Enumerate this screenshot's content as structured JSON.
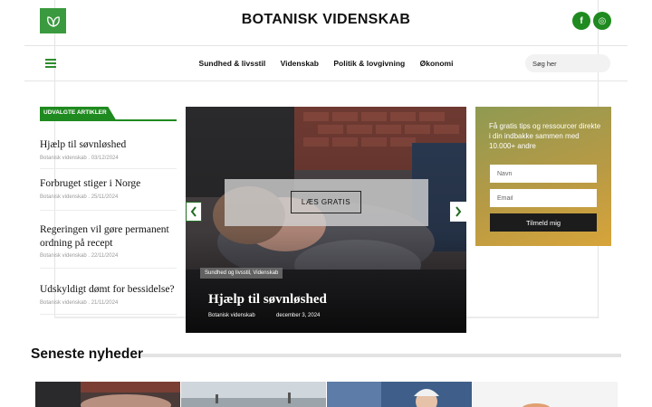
{
  "header": {
    "site_title": "BOTANISK VIDENSKAB",
    "logo_icon": "leaf-icon",
    "social": [
      {
        "icon": "facebook-icon",
        "glyph": "f"
      },
      {
        "icon": "instagram-icon",
        "glyph": "◎"
      }
    ]
  },
  "nav": {
    "menu_icon": "hamburger-menu-icon",
    "links": [
      "Sundhed & livsstil",
      "Videnskab",
      "Politik & lovgivning",
      "Økonomi"
    ],
    "search_placeholder": "Søg her"
  },
  "featured": {
    "label": "UDVALGTE ARTIKLER",
    "articles": [
      {
        "title": "Hjælp til søvnløshed",
        "meta": "Botanisk videnskab . 03/12/2024"
      },
      {
        "title": "Forbruget stiger i Norge",
        "meta": "Botanisk videnskab . 25/11/2024"
      },
      {
        "title": "Regeringen vil gøre permanent ordning på recept",
        "meta": "Botanisk videnskab . 22/11/2024"
      },
      {
        "title": "Udskyldigt dømt for bessidelse?",
        "meta": "Botanisk videnskab . 21/11/2024"
      }
    ]
  },
  "slider": {
    "popup_button": "LÆS GRATIS",
    "category": "Sundhed og livsstil, Videnskab",
    "title": "Hjælp til søvnløshed",
    "author": "Botanisk videnskab",
    "date": "december 3, 2024",
    "prev_icon": "chevron-left-icon",
    "next_icon": "chevron-right-icon"
  },
  "newsletter": {
    "text": "Få gratis tips og ressourcer direkte i din indbakke sammen med 10.000+ andre",
    "name_placeholder": "Navn",
    "email_placeholder": "Email",
    "button": "Tilmeld mig"
  },
  "latest": {
    "title": "Seneste nyheder"
  },
  "colors": {
    "brand_green": "#1f8a1f",
    "newsletter_gradient_start": "#8f9a52",
    "newsletter_gradient_end": "#d7a43a"
  }
}
